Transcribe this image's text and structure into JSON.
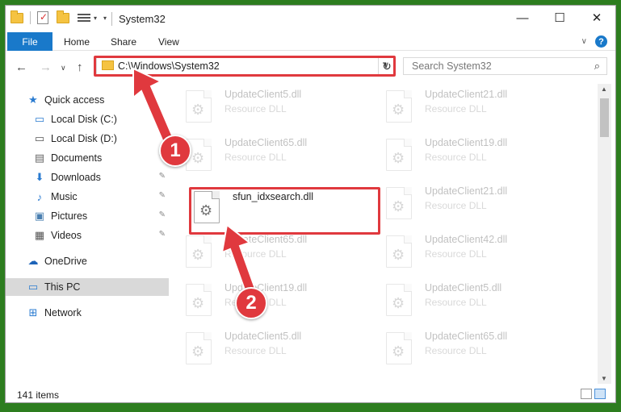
{
  "window": {
    "title": "System32"
  },
  "ribbon": {
    "file_label": "File",
    "tabs": [
      "Home",
      "Share",
      "View"
    ]
  },
  "address": {
    "path": "C:\\Windows\\System32"
  },
  "search": {
    "placeholder": "Search System32"
  },
  "sidebar": {
    "items": [
      {
        "label": "Quick access",
        "icon": "star-icon"
      },
      {
        "label": "Local Disk (C:)",
        "icon": "drive-icon"
      },
      {
        "label": "Local Disk (D:)",
        "icon": "drive-icon"
      },
      {
        "label": "Documents",
        "icon": "documents-icon"
      },
      {
        "label": "Downloads",
        "icon": "download-icon"
      },
      {
        "label": "Music",
        "icon": "music-icon"
      },
      {
        "label": "Pictures",
        "icon": "pictures-icon"
      },
      {
        "label": "Videos",
        "icon": "videos-icon"
      },
      {
        "label": "OneDrive",
        "icon": "cloud-icon"
      },
      {
        "label": "This PC",
        "icon": "computer-icon"
      },
      {
        "label": "Network",
        "icon": "network-icon"
      }
    ]
  },
  "files": [
    {
      "name": "UpdateClient5.dll",
      "type": "Resource DLL"
    },
    {
      "name": "UpdateClient21.dll",
      "type": "Resource DLL"
    },
    {
      "name": "UpdateClient65.dll",
      "type": "Resource DLL"
    },
    {
      "name": "UpdateClient19.dll",
      "type": "Resource DLL"
    },
    {
      "name": "sfun_idxsearch.dll",
      "type": ""
    },
    {
      "name": "UpdateClient21.dll",
      "type": "Resource DLL"
    },
    {
      "name": "UpdateClient65.dll",
      "type": "Resource DLL"
    },
    {
      "name": "UpdateClient42.dll",
      "type": "Resource DLL"
    },
    {
      "name": "UpdateClient19.dll",
      "type": "Resource DLL"
    },
    {
      "name": "UpdateClient5.dll",
      "type": "Resource DLL"
    },
    {
      "name": "UpdateClient5.dll",
      "type": "Resource DLL"
    },
    {
      "name": "UpdateClient65.dll",
      "type": "Resource DLL"
    }
  ],
  "status": {
    "item_count": "141 items"
  },
  "annotations": {
    "badge1": "1",
    "badge2": "2",
    "color": "#e0393e"
  }
}
